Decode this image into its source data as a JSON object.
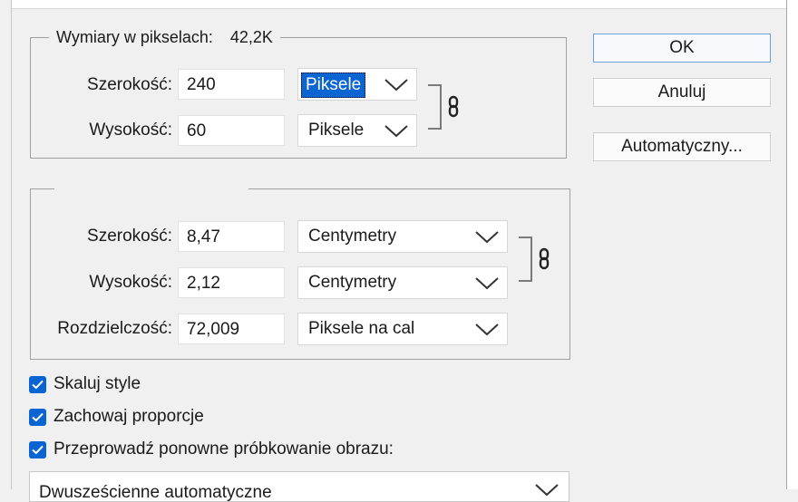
{
  "pixel_dims": {
    "legend_label": "Wymiary w pikselach:",
    "legend_value": "42,2K",
    "width_label": "Szerokość:",
    "width_value": "240",
    "width_unit": "Piksele",
    "height_label": "Wysokość:",
    "height_value": "60",
    "height_unit": "Piksele"
  },
  "doc_size": {
    "width_label": "Szerokość:",
    "width_value": "8,47",
    "width_unit": "Centymetry",
    "height_label": "Wysokość:",
    "height_value": "2,12",
    "height_unit": "Centymetry",
    "resolution_label": "Rozdzielczość:",
    "resolution_value": "72,009",
    "resolution_unit": "Piksele na cal"
  },
  "buttons": {
    "ok": "OK",
    "cancel": "Anuluj",
    "auto": "Automatyczny..."
  },
  "checkboxes": {
    "scale_styles": "Skaluj style",
    "constrain": "Zachowaj proporcje",
    "resample": "Przeprowadź ponowne próbkowanie obrazu:"
  },
  "resample_method": "Dwusześcienne automatyczne",
  "colors": {
    "accent": "#0a64d2",
    "background": "#f0f0f0"
  },
  "icons": {
    "chain": "link-chain-icon",
    "dropdown": "chevron-down-icon",
    "check": "checkmark-icon"
  }
}
